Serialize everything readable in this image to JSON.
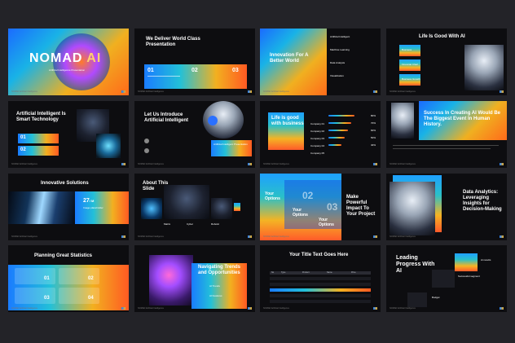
{
  "colors": {
    "bg": "#232328",
    "slide": "#0d0d10",
    "accent_blue": "#1a7cff",
    "accent_orange": "#f2b020"
  },
  "s1": {
    "title": "NOMAD",
    "title_ai": "AI",
    "subtitle": "Artificial Intelligence Presentation"
  },
  "s2": {
    "title": "We Deliver World Class Presentation",
    "n1": "01",
    "n2": "02",
    "n3": "03"
  },
  "s3": {
    "title": "Innovation For A Better World",
    "items": [
      "Artificial Intelligent",
      "Machine Learning",
      "Data Analysis",
      "Visualization"
    ]
  },
  "s4": {
    "title": "Life Is Good With AI",
    "items": [
      "Business",
      "Financial Chart",
      "Business Growth"
    ]
  },
  "s5": {
    "title": "Artificial Intelligent Is Smart Technology",
    "n1": "01",
    "n2": "02"
  },
  "s6": {
    "title": "Let Us Introduce Artificial Intelligent",
    "caption": "Artificial Intelligent Presentation"
  },
  "s7": {
    "title": "Life is good with business",
    "companies": [
      "Company 01",
      "Company 02",
      "Company 03",
      "Company 04",
      "Company 05"
    ],
    "percents": [
      "80%",
      "70%",
      "60%",
      "50%",
      "40%"
    ],
    "values": [
      80,
      70,
      60,
      50,
      40
    ]
  },
  "s8": {
    "title": "Success In Creating AI Would Be The Biggest Event In Human History."
  },
  "s9": {
    "title": "Innovative Solutions",
    "stat": "27",
    "stat_unit": "/ M",
    "label": "Image placeholder"
  },
  "s10": {
    "title": "About This Slide",
    "items": [
      "Matrix",
      "Cyber",
      "Robotic"
    ]
  },
  "s11": {
    "options": [
      "Your Options",
      "Your Options",
      "Your Options"
    ],
    "n2": "02",
    "n3": "03",
    "heading": "Make Powerful Impact To Your Project"
  },
  "s12": {
    "title": "Data Analytics: Leveraging Insights for Decision-Making"
  },
  "s13": {
    "title": "Planning Great Statistics",
    "nums": [
      "01",
      "02",
      "03",
      "04"
    ]
  },
  "s14": {
    "title": "Navigating Trends and Opportunities",
    "items": [
      "AI Trends",
      "AI Features"
    ]
  },
  "s15": {
    "title": "Your Title Text Goes Here",
    "headers": [
      "No",
      "Type",
      "Product",
      "Name",
      "Price"
    ]
  },
  "s16": {
    "title": "Leading Progress With AI",
    "labels": [
      "Ai results",
      "Successful segment",
      "Budget"
    ]
  },
  "footer": {
    "brand": "NOMAD",
    "text": "Artificial Intelligence"
  }
}
